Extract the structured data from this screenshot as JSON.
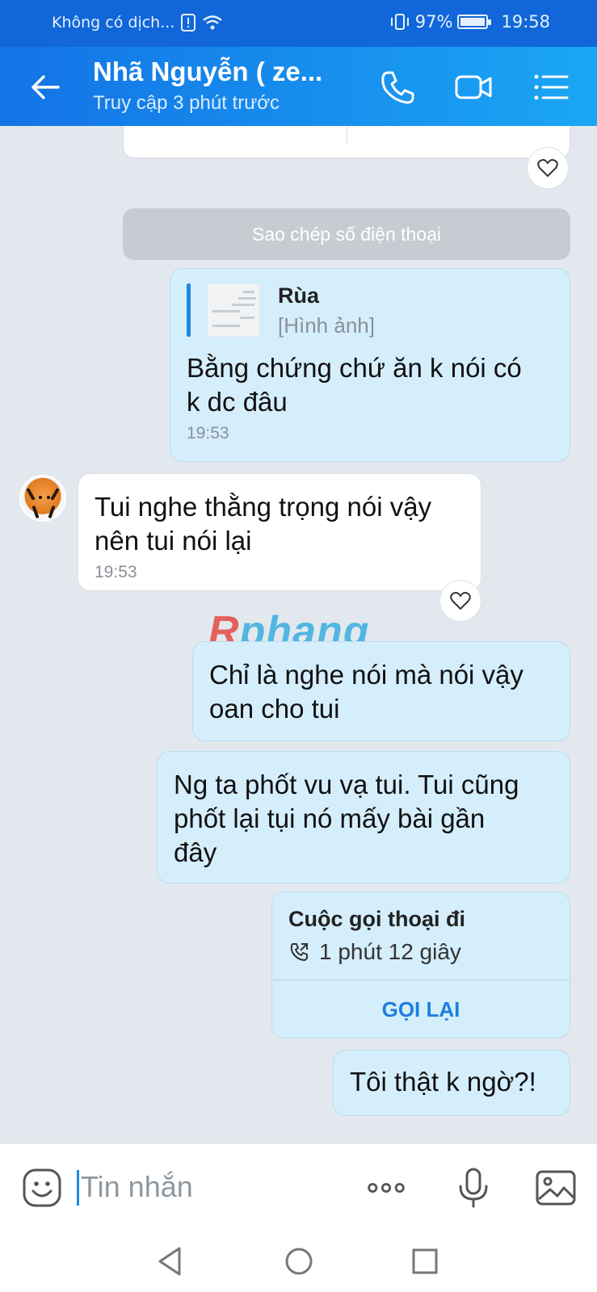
{
  "status_bar": {
    "carrier": "Không có dịch...",
    "battery": "97%",
    "battery_level": 0.97,
    "time": "19:58"
  },
  "header": {
    "contact_name": "Nhã Nguyễn ( ze...",
    "last_seen": "Truy cập 3 phút trước"
  },
  "chat": {
    "system_action": "Sao chép số điện thoại",
    "messages": [
      {
        "from": "me",
        "quote_name": "Rùa",
        "quote_type": "[Hình ảnh]",
        "line1": "Bằng chứng chứ ăn k nói có",
        "line2": "k dc đâu",
        "time": "19:53"
      },
      {
        "from": "them",
        "line1": "Tui nghe thằng trọng nói vậy",
        "line2": "nên tui nói lại",
        "time": "19:53"
      },
      {
        "from": "me",
        "line1": "Chỉ là nghe nói mà nói vậy",
        "line2": "oan cho tui"
      },
      {
        "from": "me",
        "line1": "Ng ta phốt vu vạ tui. Tui cũng",
        "line2": "phốt lại tụi nó mấy bài gần",
        "line3": "đây"
      },
      {
        "from": "me",
        "line1": "Tôi thật k ngờ?!"
      }
    ],
    "call": {
      "title": "Cuộc gọi thoại đi",
      "duration": "1 phút 12 giây",
      "call_back": "GỌI LẠI"
    },
    "watermark": {
      "r": "R",
      "rest": "phang"
    }
  },
  "input": {
    "placeholder": "Tin nhắn"
  },
  "icons": {
    "back": "arrow-left-icon",
    "call": "phone-icon",
    "video": "video-camera-icon",
    "menu": "menu-icon",
    "emoji": "emoji-icon",
    "more": "more-icon",
    "mic": "microphone-icon",
    "image": "image-icon"
  },
  "colors": {
    "header_start": "#1373e6",
    "header_end": "#1aa6f4",
    "my_bubble": "#d5eefc",
    "their_bubble": "#ffffff",
    "chat_bg": "#e2e8ed",
    "link": "#1e7ee0"
  }
}
